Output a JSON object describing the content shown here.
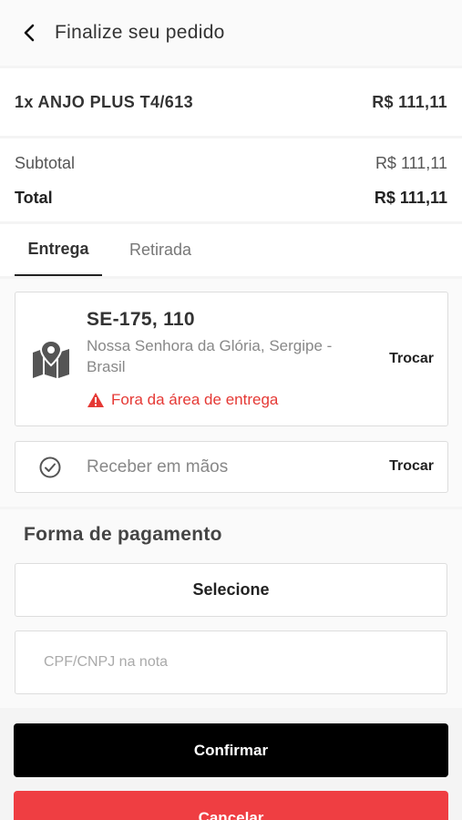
{
  "header": {
    "title": "Finalize seu pedido",
    "back_icon": "chevron-left-icon"
  },
  "item": {
    "name": "1x ANJO PLUS T4/613",
    "price": "R$ 111,11"
  },
  "totals": {
    "subtotal_label": "Subtotal",
    "subtotal_value": "R$ 111,11",
    "total_label": "Total",
    "total_value": "R$ 111,11"
  },
  "tabs": [
    {
      "label": "Entrega",
      "active": true
    },
    {
      "label": "Retirada",
      "active": false
    }
  ],
  "address": {
    "icon": "map-pin-icon",
    "street": "SE-175, 110",
    "city": "Nossa Senhora da Glória, Sergipe - Brasil",
    "warning": "Fora da área de entrega",
    "warning_color": "#e53935",
    "change_label": "Trocar"
  },
  "delivery_option": {
    "icon": "check-circle-icon",
    "label": "Receber em mãos",
    "change_label": "Trocar"
  },
  "payment": {
    "title": "Forma de pagamento",
    "select_label": "Selecione",
    "cpf_placeholder": "CPF/CNPJ na nota"
  },
  "actions": {
    "confirm_label": "Confirmar",
    "confirm_color": "#000000",
    "cancel_label": "Cancelar",
    "cancel_color": "#ef3e42"
  }
}
